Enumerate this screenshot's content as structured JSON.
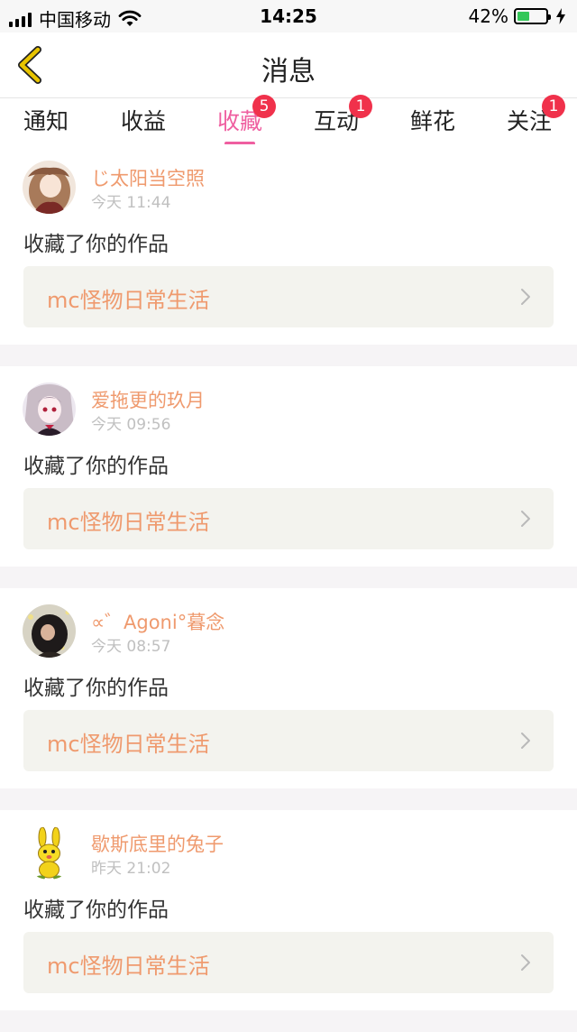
{
  "status_bar": {
    "carrier": "中国移动",
    "time": "14:25",
    "battery_percent": "42%",
    "battery_level": 0.42,
    "icons": [
      "signal-icon",
      "wifi-icon",
      "battery-icon",
      "charging-icon"
    ]
  },
  "header": {
    "title": "消息",
    "back_icon": "chevron-left-icon"
  },
  "colors": {
    "accent": "#ef5fa0",
    "badge": "#f0314b",
    "username": "#ef9a6e",
    "back_icon": "#e8c400"
  },
  "tabs": [
    {
      "label": "通知",
      "active": false
    },
    {
      "label": "收益",
      "active": false
    },
    {
      "label": "收藏",
      "active": true,
      "badge": "5"
    },
    {
      "label": "互动",
      "active": false,
      "badge": "1"
    },
    {
      "label": "鲜花",
      "active": false
    },
    {
      "label": "关注",
      "active": false,
      "badge": "1"
    }
  ],
  "messages": [
    {
      "username": "じ太阳当空照",
      "time": "今天 11:44",
      "action": "收藏了你的作品",
      "work_title": "mc怪物日常生活"
    },
    {
      "username": "爱拖更的玖月",
      "time": "今天 09:56",
      "action": "收藏了你的作品",
      "work_title": "mc怪物日常生活"
    },
    {
      "username": "∝゛Agoni°暮念",
      "time": "今天 08:57",
      "action": "收藏了你的作品",
      "work_title": "mc怪物日常生活"
    },
    {
      "username": "歇斯底里的兔子",
      "time": "昨天 21:02",
      "action": "收藏了你的作品",
      "work_title": "mc怪物日常生活"
    }
  ]
}
